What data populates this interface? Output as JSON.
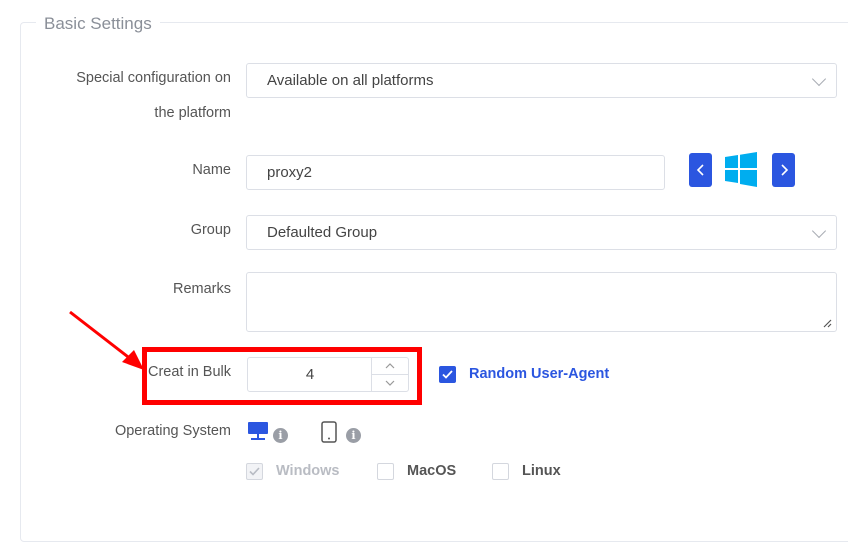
{
  "section": {
    "legend": "Basic Settings"
  },
  "platform": {
    "label_line1": "Special configuration on",
    "label_line2": "the platform",
    "selected": "Available on all platforms"
  },
  "name": {
    "label": "Name",
    "value": "proxy2"
  },
  "group": {
    "label": "Group",
    "selected": "Defaulted Group"
  },
  "remarks": {
    "label": "Remarks",
    "value": ""
  },
  "bulk": {
    "label": "Creat in Bulk",
    "value": "4"
  },
  "random_ua": {
    "label": "Random User-Agent",
    "checked": true
  },
  "os": {
    "label": "Operating System",
    "options": [
      {
        "label": "Windows",
        "checked": true,
        "disabled": true
      },
      {
        "label": "MacOS",
        "checked": false
      },
      {
        "label": "Linux",
        "checked": false
      }
    ]
  },
  "icons": {
    "info": "info-icon",
    "desktop": "desktop-icon",
    "mobile": "mobile-icon",
    "windows": "windows-logo-icon",
    "prev": "chevron-left-icon",
    "next": "chevron-right-icon",
    "annotation": "red-arrow-annotation"
  },
  "colors": {
    "primary": "#2b56e0",
    "link": "#2b56e0",
    "windows_logo": "#00adef",
    "annotation": "#ff0000"
  }
}
